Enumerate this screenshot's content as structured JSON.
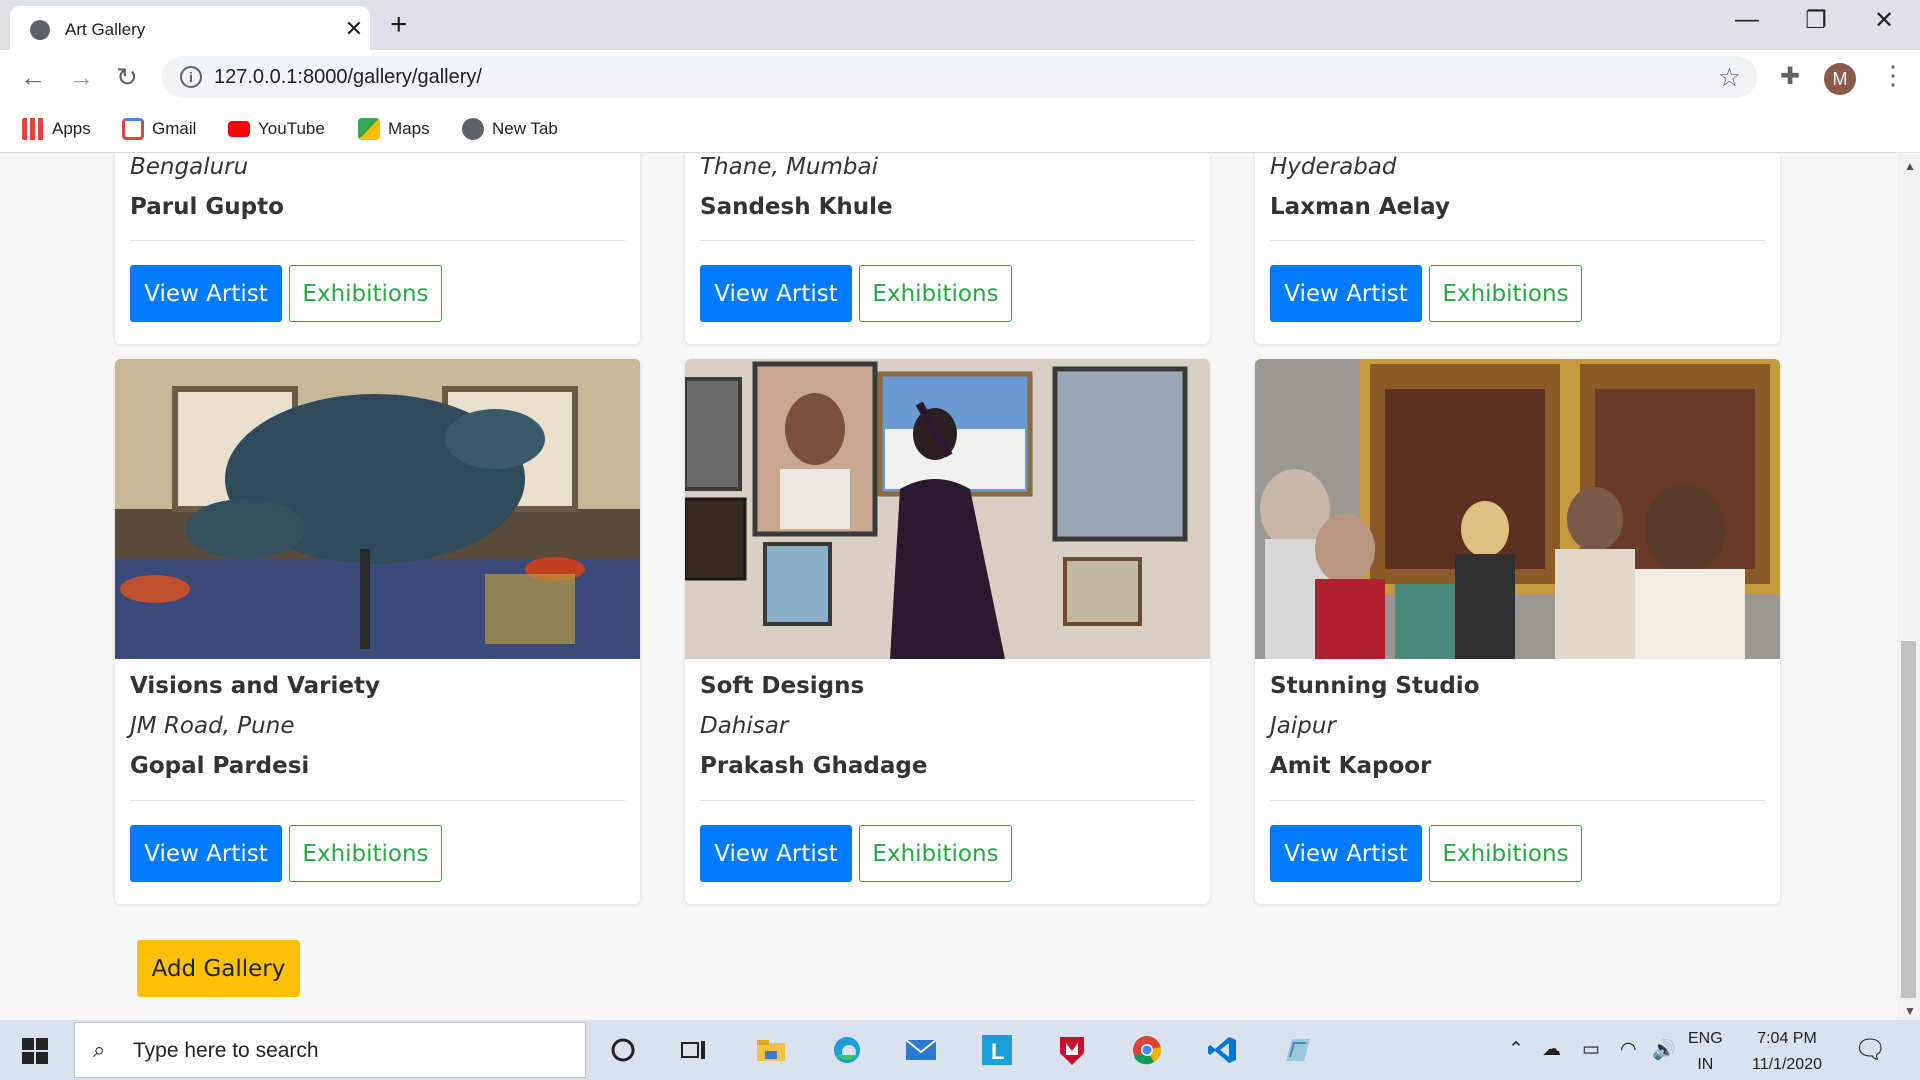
{
  "browser": {
    "tab_title": "Art Gallery",
    "close_glyph": "✕",
    "new_tab_glyph": "+",
    "minimize_glyph": "—",
    "restore_glyph": "❐",
    "close_window_glyph": "✕",
    "back_glyph": "←",
    "forward_glyph": "→",
    "reload_glyph": "↻",
    "url": "127.0.0.1:8000/gallery/gallery/",
    "info_glyph": "i",
    "star_glyph": "☆",
    "extensions_glyph": "✚",
    "avatar_letter": "M",
    "menu_glyph": "⋮",
    "bookmarks": [
      {
        "label": "Apps",
        "icon": "apps-grid-icon",
        "color": "#4285f4"
      },
      {
        "label": "Gmail",
        "icon": "gmail-icon",
        "color": "#ea4335"
      },
      {
        "label": "YouTube",
        "icon": "youtube-icon",
        "color": "#ff0000"
      },
      {
        "label": "Maps",
        "icon": "maps-icon",
        "color": "#34a853"
      },
      {
        "label": "New Tab",
        "icon": "globe-icon",
        "color": "#5f6368"
      }
    ]
  },
  "galleries_top_row": [
    {
      "location": "Bengaluru",
      "owner": "Parul Gupto",
      "view_label": "View Artist",
      "exhibitions_label": "Exhibitions"
    },
    {
      "location": "Thane, Mumbai",
      "owner": "Sandesh Khule",
      "view_label": "View Artist",
      "exhibitions_label": "Exhibitions"
    },
    {
      "location": "Hyderabad",
      "owner": "Laxman Aelay",
      "view_label": "View Artist",
      "exhibitions_label": "Exhibitions"
    }
  ],
  "galleries_bottom_row": [
    {
      "title": "Visions and Variety",
      "location": "JM Road, Pune",
      "owner": "Gopal Pardesi",
      "view_label": "View Artist",
      "exhibitions_label": "Exhibitions"
    },
    {
      "title": "Soft Designs",
      "location": "Dahisar",
      "owner": "Prakash Ghadage",
      "view_label": "View Artist",
      "exhibitions_label": "Exhibitions"
    },
    {
      "title": "Stunning Studio",
      "location": "Jaipur",
      "owner": "Amit Kapoor",
      "view_label": "View Artist",
      "exhibitions_label": "Exhibitions"
    }
  ],
  "add_gallery_label": "Add Gallery",
  "colors": {
    "primary": "#007bff",
    "success": "#28a745",
    "warning": "#ffc107"
  },
  "taskbar": {
    "search_placeholder": "Type here to search",
    "search_glyph": "⌕",
    "lang_top": "ENG",
    "lang_bottom": "IN",
    "time": "7:04 PM",
    "date": "11/1/2020",
    "notification_glyph": "🗨"
  }
}
